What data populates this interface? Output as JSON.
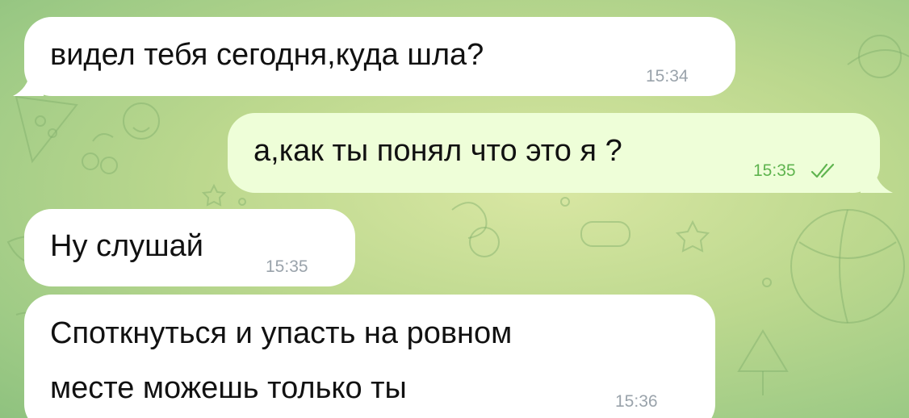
{
  "chat": {
    "messages": [
      {
        "direction": "incoming",
        "lines": [
          "видел тебя сегодня,куда шла?"
        ],
        "time": "15:34"
      },
      {
        "direction": "outgoing",
        "lines": [
          "а,как ты понял что это я ?"
        ],
        "time": "15:35",
        "status": "read"
      },
      {
        "direction": "incoming",
        "lines": [
          "Ну слушай"
        ],
        "time": "15:35"
      },
      {
        "direction": "incoming",
        "lines": [
          "Споткнуться и упасть на ровном",
          "месте можешь только ты"
        ],
        "time": "15:36"
      }
    ]
  },
  "theme": {
    "incoming_bubble": "#ffffff",
    "outgoing_bubble": "#eefed8",
    "read_check_color": "#5fb44f",
    "background": "#b7d68c"
  },
  "icons": {
    "read_receipt": "double-check-icon"
  }
}
